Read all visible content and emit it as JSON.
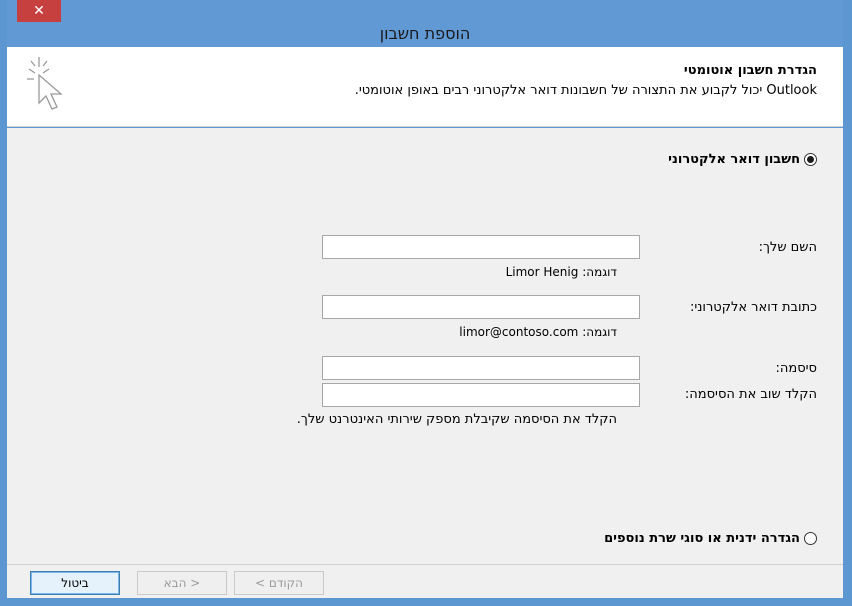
{
  "window": {
    "title": "הוספת חשבון",
    "close_glyph": "✕"
  },
  "header": {
    "title": "הגדרת חשבון אוטומטי",
    "description": "Outlook יכול לקבוע את התצורה של חשבונות דואר אלקטרוני רבים באופן אוטומטי."
  },
  "options": {
    "email_account": {
      "label": "חשבון דואר אלקטרוני",
      "selected": true
    },
    "manual_setup": {
      "label": "הגדרה ידנית או סוגי שרת נוספים",
      "selected": false
    }
  },
  "form": {
    "name": {
      "label": "השם שלך:",
      "value": "",
      "example_prefix": "דוגמה:",
      "example_value": "Limor Henig"
    },
    "email": {
      "label": "כתובת דואר אלקטרוני:",
      "value": "",
      "example_prefix": "דוגמה:",
      "example_value": "limor@contoso.com"
    },
    "password": {
      "label": "סיסמה:",
      "value": ""
    },
    "retype_password": {
      "label": "הקלד שוב את הסיסמה:",
      "value": ""
    },
    "password_hint": "הקלד את הסיסמה שקיבלת מספק שירותי האינטרנט שלך."
  },
  "footer": {
    "back_label": "< הקודם",
    "next_label": "הבא >",
    "cancel_label": "ביטול"
  }
}
